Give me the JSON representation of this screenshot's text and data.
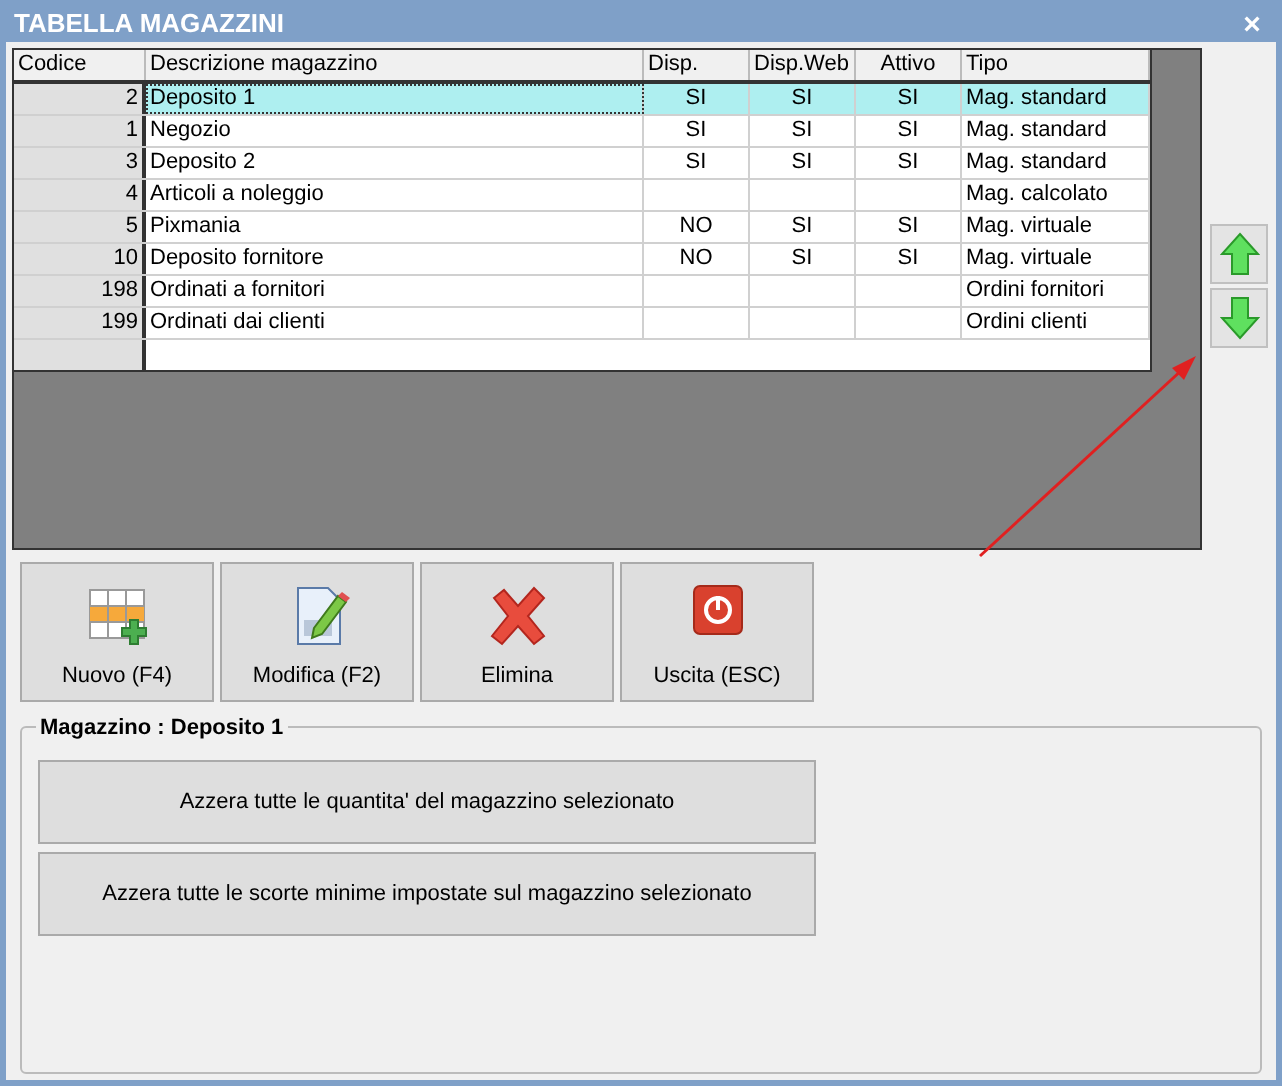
{
  "window": {
    "title": "TABELLA MAGAZZINI",
    "close": "×"
  },
  "table": {
    "columns": [
      "Codice",
      "Descrizione magazzino",
      "Disp.",
      "Disp.Web",
      "Attivo",
      "Tipo"
    ],
    "rows": [
      {
        "cells": [
          "2",
          "Deposito 1",
          "SI",
          "SI",
          "SI",
          "Mag. standard"
        ],
        "selected": true
      },
      {
        "cells": [
          "1",
          "Negozio",
          "SI",
          "SI",
          "SI",
          "Mag. standard"
        ],
        "selected": false
      },
      {
        "cells": [
          "3",
          "Deposito 2",
          "SI",
          "SI",
          "SI",
          "Mag. standard"
        ],
        "selected": false
      },
      {
        "cells": [
          "4",
          "Articoli a noleggio",
          "",
          "",
          "",
          "Mag. calcolato"
        ],
        "selected": false
      },
      {
        "cells": [
          "5",
          "Pixmania",
          "NO",
          "SI",
          "SI",
          "Mag. virtuale"
        ],
        "selected": false
      },
      {
        "cells": [
          "10",
          "Deposito fornitore",
          "NO",
          "SI",
          "SI",
          "Mag. virtuale"
        ],
        "selected": false
      },
      {
        "cells": [
          "198",
          "Ordinati a fornitori",
          "",
          "",
          "",
          "Ordini fornitori"
        ],
        "selected": false
      },
      {
        "cells": [
          "199",
          "Ordinati dai clienti",
          "",
          "",
          "",
          "Ordini clienti"
        ],
        "selected": false
      }
    ]
  },
  "toolbar": [
    {
      "kind": "new",
      "label": "Nuovo (F4)"
    },
    {
      "kind": "edit",
      "label": "Modifica (F2)"
    },
    {
      "kind": "delete",
      "label": "Elimina"
    },
    {
      "kind": "exit",
      "label": "Uscita (ESC)"
    }
  ],
  "group": {
    "title": "Magazzino : Deposito 1",
    "buttons": [
      "Azzera tutte le quantita' del magazzino selezionato",
      "Azzera tutte le scorte minime impostate sul magazzino selezionato"
    ]
  }
}
